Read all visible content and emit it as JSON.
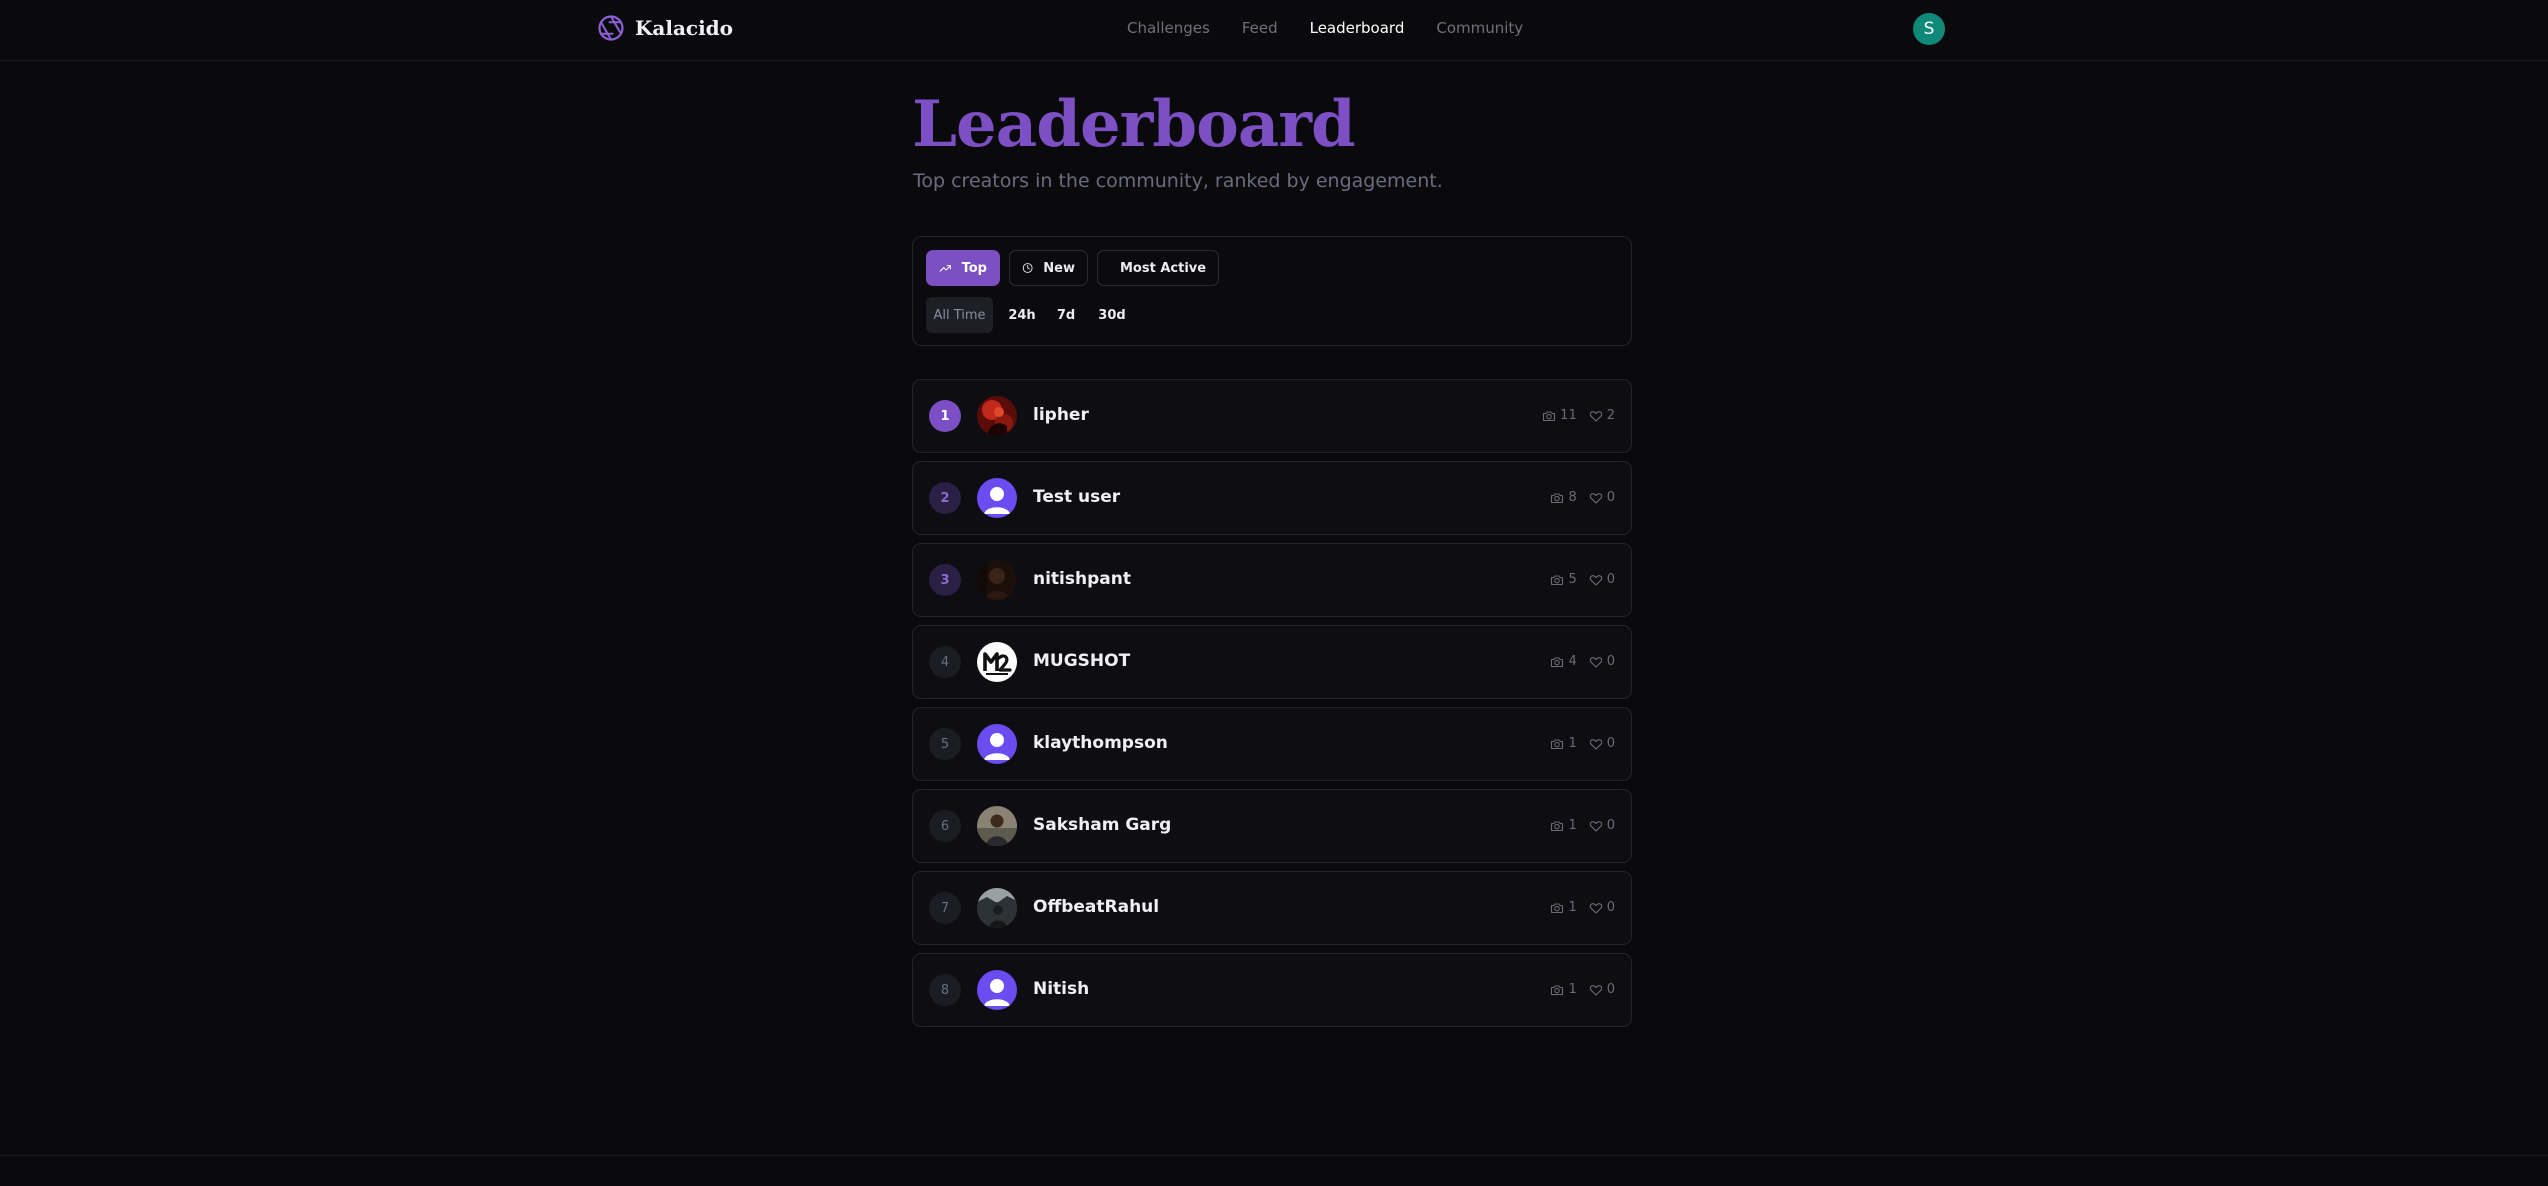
{
  "app": {
    "name": "Kalacido"
  },
  "nav": {
    "items": [
      {
        "label": "Challenges",
        "active": false
      },
      {
        "label": "Feed",
        "active": false
      },
      {
        "label": "Leaderboard",
        "active": true
      },
      {
        "label": "Community",
        "active": false
      }
    ]
  },
  "user": {
    "initial": "S",
    "avatar_color": "#0f8a78"
  },
  "header": {
    "title": "Leaderboard",
    "subtitle": "Top creators in the community, ranked by engagement."
  },
  "filters": {
    "sort_tabs": [
      {
        "label": "Top",
        "icon": "trending-up-icon",
        "active": true
      },
      {
        "label": "New",
        "icon": "clock-icon",
        "active": false
      },
      {
        "label": "Most Active",
        "icon": "flame-icon",
        "active": false
      }
    ],
    "time_ranges": [
      {
        "label": "All Time",
        "active": true
      },
      {
        "label": "24h",
        "active": false
      },
      {
        "label": "7d",
        "active": false
      },
      {
        "label": "30d",
        "active": false
      }
    ]
  },
  "leaderboard": [
    {
      "rank": "1",
      "name": "lipher",
      "avatar": "photo-red",
      "photos": "11",
      "likes": "2"
    },
    {
      "rank": "2",
      "name": "Test user",
      "avatar": "default-user",
      "photos": "8",
      "likes": "0"
    },
    {
      "rank": "3",
      "name": "nitishpant",
      "avatar": "photo-dark",
      "photos": "5",
      "likes": "0"
    },
    {
      "rank": "4",
      "name": "MUGSHOT",
      "avatar": "logo-mugshot",
      "photos": "4",
      "likes": "0"
    },
    {
      "rank": "5",
      "name": "klaythompson",
      "avatar": "default-user",
      "photos": "1",
      "likes": "0"
    },
    {
      "rank": "6",
      "name": "Saksham Garg",
      "avatar": "photo-person",
      "photos": "1",
      "likes": "0"
    },
    {
      "rank": "7",
      "name": "OffbeatRahul",
      "avatar": "photo-landscape",
      "photos": "1",
      "likes": "0"
    },
    {
      "rank": "8",
      "name": "Nitish",
      "avatar": "default-user",
      "photos": "1",
      "likes": "0"
    }
  ],
  "colors": {
    "accent": "#7d4fc4",
    "background": "#0a0a0d",
    "default_avatar": "#6a4cf0"
  }
}
